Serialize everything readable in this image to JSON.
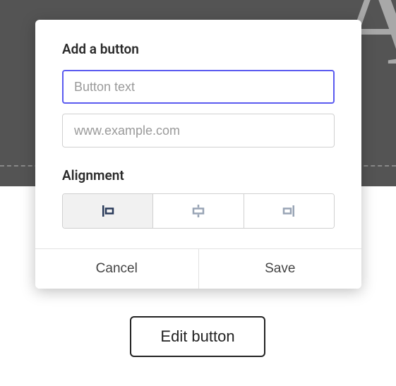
{
  "background": {
    "letter": "A"
  },
  "modal": {
    "title": "Add a button",
    "button_text": {
      "value": "",
      "placeholder": "Button text"
    },
    "url": {
      "value": "",
      "placeholder": "www.example.com"
    },
    "alignment_label": "Alignment",
    "alignment": {
      "options": [
        "left",
        "center",
        "right"
      ],
      "selected": "left"
    },
    "cancel_label": "Cancel",
    "save_label": "Save"
  },
  "edit_button_label": "Edit button",
  "colors": {
    "focus": "#5b5bf0",
    "icon_selected": "#2a3b5a",
    "icon_unselected": "#98a4b5"
  }
}
